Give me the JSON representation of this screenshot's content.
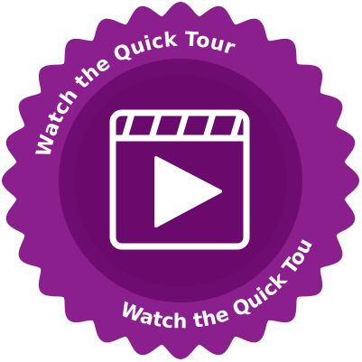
{
  "badge": {
    "top_text": "Watch the Quick Tour!",
    "bottom_text": "Watch the Quick Tour!",
    "icon": "video-clapperboard-play-icon",
    "colors": {
      "outer_seal": "#8b1f8d",
      "inner_disc": "#6f0c72",
      "inner_core": "#690a6c",
      "text": "#ffffff",
      "icon": "#ffffff"
    }
  }
}
